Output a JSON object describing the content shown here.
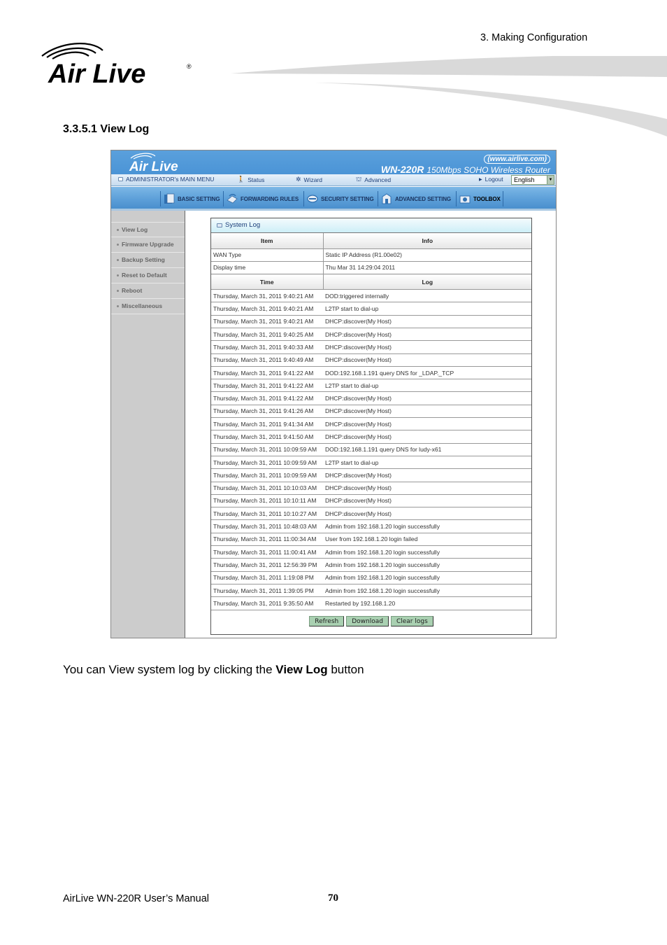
{
  "page": {
    "chapter_header": "3. Making  Configuration",
    "brand": "Air Live",
    "section_title": "3.3.5.1  View Log",
    "body_text_before": "You can View system log by clicking the ",
    "body_text_bold": "View Log",
    "body_text_after": " button",
    "footer_manual": "AirLive WN-220R User’s Manual",
    "footer_page": "70"
  },
  "router": {
    "brand": "Air Live",
    "url": "(www.airlive.com)",
    "model": "WN-220R",
    "model_desc": "150Mbps SOHO Wireless Router",
    "menu": {
      "main_menu": "ADMINISTRATOR's MAIN MENU",
      "status": "Status",
      "wizard": "Wizard",
      "advanced": "Advanced",
      "logout": "Logout",
      "language": "English"
    },
    "tabs": [
      {
        "label": "BASIC SETTING",
        "icon": "document-icon"
      },
      {
        "label": "FORWARDING RULES",
        "icon": "forward-icon"
      },
      {
        "label": "SECURITY SETTING",
        "icon": "security-icon"
      },
      {
        "label": "ADVANCED SETTING",
        "icon": "advanced-icon"
      },
      {
        "label": "TOOLBOX",
        "icon": "toolbox-icon",
        "active": true
      }
    ],
    "sidebar": [
      {
        "label": "View Log"
      },
      {
        "label": "Firmware Upgrade"
      },
      {
        "label": "Backup Setting"
      },
      {
        "label": "Reset to Default"
      },
      {
        "label": "Reboot"
      },
      {
        "label": "Miscellaneous"
      }
    ],
    "panel": {
      "title": "System Log",
      "info_headers": [
        "Item",
        "Info"
      ],
      "info_rows": [
        [
          "WAN Type",
          "Static IP Address (R1.00e02)"
        ],
        [
          "Display time",
          "Thu Mar 31 14:29:04 2011"
        ]
      ],
      "log_headers": [
        "Time",
        "Log"
      ],
      "log_rows": [
        [
          "Thursday, March 31, 2011 9:40:21 AM",
          "DOD:triggered internally"
        ],
        [
          "Thursday, March 31, 2011 9:40:21 AM",
          "L2TP start to dial-up"
        ],
        [
          "Thursday, March 31, 2011 9:40:21 AM",
          "DHCP:discover(My Host)"
        ],
        [
          "Thursday, March 31, 2011 9:40:25 AM",
          "DHCP:discover(My Host)"
        ],
        [
          "Thursday, March 31, 2011 9:40:33 AM",
          "DHCP:discover(My Host)"
        ],
        [
          "Thursday, March 31, 2011 9:40:49 AM",
          "DHCP:discover(My Host)"
        ],
        [
          "Thursday, March 31, 2011 9:41:22 AM",
          "DOD:192.168.1.191 query DNS for _LDAP._TCP"
        ],
        [
          "Thursday, March 31, 2011 9:41:22 AM",
          "L2TP start to dial-up"
        ],
        [
          "Thursday, March 31, 2011 9:41:22 AM",
          "DHCP:discover(My Host)"
        ],
        [
          "Thursday, March 31, 2011 9:41:26 AM",
          "DHCP:discover(My Host)"
        ],
        [
          "Thursday, March 31, 2011 9:41:34 AM",
          "DHCP:discover(My Host)"
        ],
        [
          "Thursday, March 31, 2011 9:41:50 AM",
          "DHCP:discover(My Host)"
        ],
        [
          "Thursday, March 31, 2011 10:09:59 AM",
          "DOD:192.168.1.191 query DNS for ludy-x61"
        ],
        [
          "Thursday, March 31, 2011 10:09:59 AM",
          "L2TP start to dial-up"
        ],
        [
          "Thursday, March 31, 2011 10:09:59 AM",
          "DHCP:discover(My Host)"
        ],
        [
          "Thursday, March 31, 2011 10:10:03 AM",
          "DHCP:discover(My Host)"
        ],
        [
          "Thursday, March 31, 2011 10:10:11 AM",
          "DHCP:discover(My Host)"
        ],
        [
          "Thursday, March 31, 2011 10:10:27 AM",
          "DHCP:discover(My Host)"
        ],
        [
          "Thursday, March 31, 2011 10:48:03 AM",
          "Admin from 192.168.1.20 login successfully"
        ],
        [
          "Thursday, March 31, 2011 11:00:34 AM",
          "User from 192.168.1.20 login failed"
        ],
        [
          "Thursday, March 31, 2011 11:00:41 AM",
          "Admin from 192.168.1.20 login successfully"
        ],
        [
          "Thursday, March 31, 2011 12:56:39 PM",
          "Admin from 192.168.1.20 login successfully"
        ],
        [
          "Thursday, March 31, 2011 1:19:08 PM",
          "Admin from 192.168.1.20 login successfully"
        ],
        [
          "Thursday, March 31, 2011 1:39:05 PM",
          "Admin from 192.168.1.20 login successfully"
        ],
        [
          "Thursday, March 31, 2011 9:35:50 AM",
          "Restarted by 192.168.1.20"
        ]
      ],
      "buttons": {
        "refresh": "Refresh",
        "download": "Download",
        "clear": "Clear logs"
      }
    }
  },
  "colors": {
    "banner_blue": "#4b94d6",
    "sidebar_gray": "#cccccc",
    "button_green": "#a9d0b1",
    "panel_title_cyan": "#cdeef7"
  }
}
